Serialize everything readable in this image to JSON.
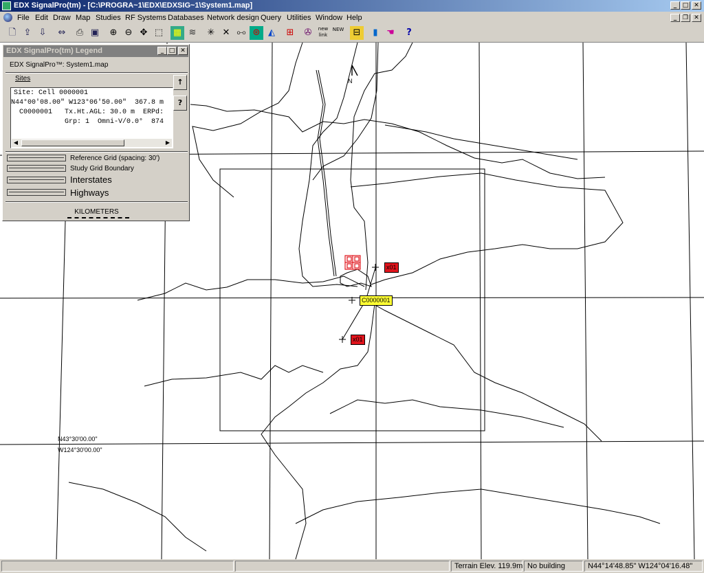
{
  "window": {
    "title": "EDX SignalPro(tm) - [C:\\PROGRA~1\\EDX\\EDXSIG~1\\System1.map]",
    "controls": {
      "minimize": "_",
      "maximize": "□",
      "close": "✕",
      "restore": "❐"
    }
  },
  "menu": [
    "File",
    "Edit",
    "Draw",
    "Map",
    "Studies",
    "RF Systems",
    "Databases",
    "Network design",
    "Query",
    "Utilities",
    "Window",
    "Help"
  ],
  "toolbar": {
    "icons": [
      "new-icon",
      "open-icon",
      "save-icon",
      "print-setup-icon",
      "print-icon",
      "copy-icon",
      "zoom-in-icon",
      "zoom-out-icon",
      "pan-icon",
      "zoom-window-icon",
      "terrain-icon",
      "layers-icon",
      "site-icon",
      "link-icon",
      "measure-icon",
      "target-icon",
      "profile-icon",
      "grid-icon",
      "network-icon",
      "new-link-icon",
      "new-site-icon",
      "ruler-icon",
      "building-icon",
      "hand-icon",
      "help-icon"
    ],
    "new_link_label": "new link",
    "new_site_label": "NEW"
  },
  "legend": {
    "title": "EDX SignalPro(tm) Legend",
    "subtitle": "EDX SignalPro™: System1.map",
    "sites_label": "Sites",
    "site_lines": [
      "Site: Cell 0000001",
      "N44°00'08.00\" W123°06'50.00\"  367.8 m",
      "  C0000001   Tx.Ht.AGL: 30.0 m  ERPd:",
      "             Grp: 1  Omni-V/0.0°  874"
    ],
    "side_buttons": [
      "↑",
      "?"
    ],
    "items": [
      "Reference Grid (spacing: 30')",
      "Study Grid Boundary",
      "Interstates",
      "Highways"
    ],
    "scale_label": "KILOMETERS"
  },
  "map": {
    "north_label": "N",
    "sites": [
      {
        "label": "C0000001",
        "color": "#ffff33"
      },
      {
        "label": "x01",
        "color": "#e0141c"
      },
      {
        "label": "x01",
        "color": "#e0141c"
      }
    ],
    "coord_lat": "N43°30'00.00\"",
    "coord_lon": "W124°30'00.00\""
  },
  "status": {
    "terrain": "Terrain Elev. 119.9m",
    "building": "No building",
    "coords": "N44°14'48.85\" W124°04'16.48\""
  }
}
